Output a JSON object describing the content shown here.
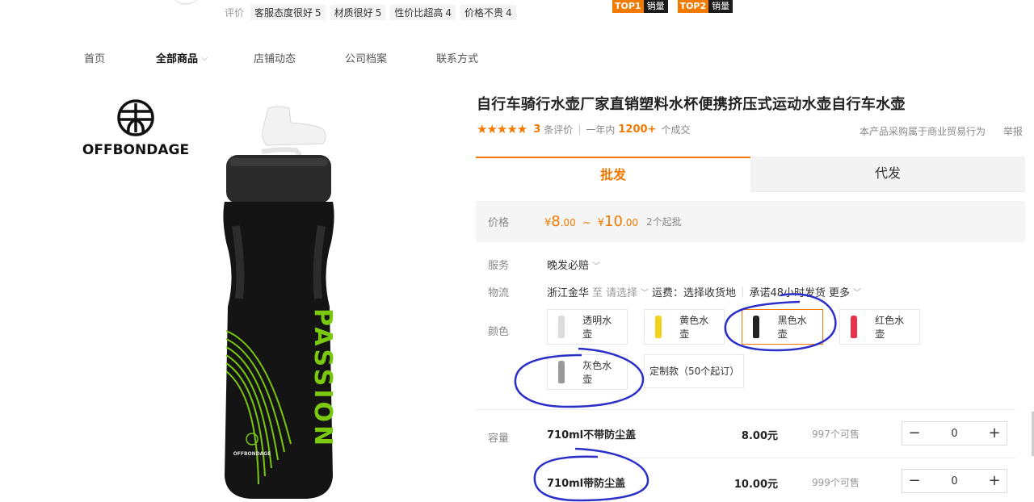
{
  "header": {
    "rating_label": "评价",
    "ratings": [
      {
        "label": "客服态度很好",
        "score": "5"
      },
      {
        "label": "材质很好",
        "score": "5"
      },
      {
        "label": "性价比超高",
        "score": "4"
      },
      {
        "label": "价格不贵",
        "score": "4"
      }
    ],
    "badges": [
      {
        "top": "TOP1",
        "text": "销量"
      },
      {
        "top": "TOP2",
        "text": "销量"
      }
    ]
  },
  "nav": {
    "items": [
      "首页",
      "全部商品",
      "店铺动态",
      "公司档案",
      "联系方式"
    ]
  },
  "brand": {
    "name": "OFFBONDAGE"
  },
  "bottle": {
    "text": "PASSION",
    "logo_text": "OFFBONDAGE"
  },
  "product": {
    "title": "自行车骑行水壶厂家直销塑料水杯便携挤压式运动水壶自行车水壶",
    "stars": "★★★★★",
    "review_count": "3",
    "review_label": "条评价",
    "period": "一年内",
    "deals": "1200+",
    "deals_label": "个成交",
    "trade_note": "本产品采购属于商业贸易行为",
    "report": "举报"
  },
  "tabs": [
    "批发",
    "代发"
  ],
  "price": {
    "label": "价格",
    "yen": "¥",
    "low_int": "8",
    "low_dec": ".00",
    "tilde": "~",
    "high_int": "10",
    "high_dec": ".00",
    "moq": "2个起批"
  },
  "service": {
    "label": "服务",
    "value": "晚发必赔"
  },
  "logistics": {
    "label": "物流",
    "origin": "浙江金华",
    "to": "至",
    "select": "请选择",
    "freight": "运费：选择收货地",
    "promise": "承诺48小时发货",
    "more": "更多"
  },
  "color": {
    "label": "颜色",
    "options": [
      "透明水壶",
      "黄色水壶",
      "黑色水壶",
      "红色水壶",
      "灰色水壶"
    ],
    "custom": "定制款（50个起订）",
    "thumb_colors": [
      "#dcdcdc",
      "#f2d21a",
      "#222222",
      "#e8324a",
      "#9a9a9a"
    ]
  },
  "capacity": {
    "label": "容量",
    "rows": [
      {
        "name": "710ml不带防尘盖",
        "price": "8.00元",
        "stock": "997个可售",
        "qty": "0"
      },
      {
        "name": "710ml带防尘盖",
        "price": "10.00元",
        "stock": "999个可售",
        "qty": "0"
      }
    ]
  },
  "colors": {
    "accent": "#f27a00",
    "annotation": "#2b2fc9",
    "bottle_green": "#7ac90f"
  }
}
